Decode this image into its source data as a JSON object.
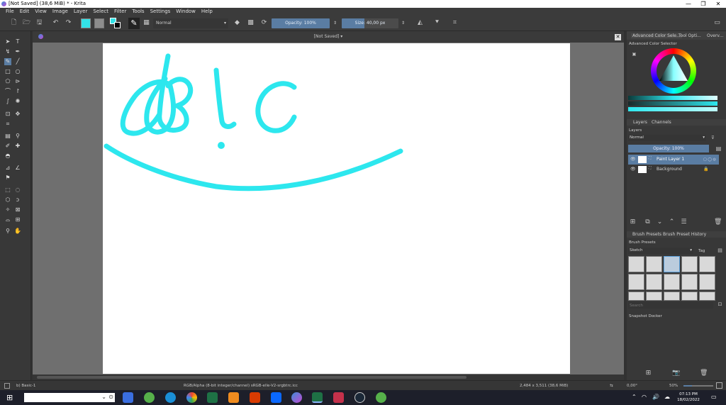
{
  "window": {
    "title": "[Not Saved]  (38,6 MiB)  * - Krita"
  },
  "menu": [
    "File",
    "Edit",
    "View",
    "Image",
    "Layer",
    "Select",
    "Filter",
    "Tools",
    "Settings",
    "Window",
    "Help"
  ],
  "toolbar": {
    "blend_mode": "Normal",
    "opacity": "Opacity: 100%",
    "size": "Size: 40,00 px",
    "fg_color": "#33e3e8"
  },
  "document_tab": "[Not Saved]",
  "dock": {
    "top_tabs": [
      "Advanced Color Sele...",
      "Tool Opti...",
      "Overv..."
    ],
    "color_selector_title": "Advanced Color Selector",
    "layer_tabs": [
      "Layers",
      "Channels"
    ],
    "layers_title": "Layers",
    "layers_blend": "Normal",
    "layers_opacity": "Opacity:  100%",
    "layers": [
      {
        "name": "Paint Layer 1",
        "selected": true
      },
      {
        "name": "Background",
        "selected": false
      }
    ],
    "brush_tabs": [
      "Brush Presets",
      "Brush Preset History"
    ],
    "brush_title": "Brush Presets",
    "brush_tag": "Sketch",
    "tag_label": "Tag",
    "search_placeholder": "Search",
    "snapshot_title": "Snapshot Docker"
  },
  "statusbar": {
    "brush": "b) Basic-1",
    "color_space": "RGB/Alpha (8-bit integer/channel)  sRGB-elle-V2-srgbtrc.icc",
    "dimensions": "2,484 x 3,511 (38,6 MiB)",
    "rotation": "0,00°",
    "zoom": "50%"
  },
  "taskbar": {
    "time": "07:13 PM",
    "date": "18/02/2022",
    "apps": [
      "zoo-app",
      "edge",
      "chrome",
      "excel",
      "a-app",
      "office",
      "zalo",
      "krita-app",
      "excel2",
      "teams",
      "steam",
      "green-app"
    ]
  }
}
